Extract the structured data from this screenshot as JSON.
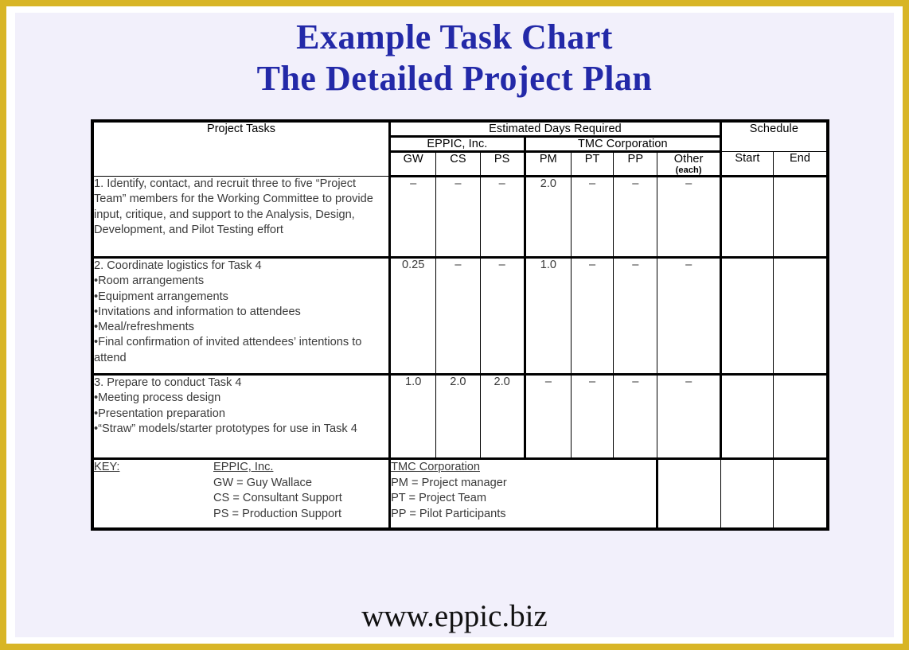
{
  "page": {
    "title_line1": "Example Task Chart",
    "title_line2": "The Detailed Project Plan",
    "footer": "www.eppic.biz",
    "title_color": "#2329a8",
    "border_color": "#d8b526",
    "background_color": "#f2f0fb"
  },
  "table": {
    "headers": {
      "project_tasks": "Project Tasks",
      "estimated_days_required": "Estimated Days Required",
      "schedule": "Schedule",
      "group_eppic": "EPPIC, Inc.",
      "group_tmc": "TMC Corporation",
      "col_gw": "GW",
      "col_cs": "CS",
      "col_ps": "PS",
      "col_pm": "PM",
      "col_pt": "PT",
      "col_pp": "PP",
      "col_other": "Other",
      "col_other_sub": "(each)",
      "col_start": "Start",
      "col_end": "End"
    },
    "rows": [
      {
        "task_title": "1. Identify, contact, and recruit three to five “Project Team” members for the Working Committee to provide input, critique, and support to the Analysis, Design, Development, and Pilot Testing effort",
        "bullets": [],
        "gw": "–",
        "cs": "–",
        "ps": "–",
        "pm": "2.0",
        "pt": "–",
        "pp": "–",
        "other": "–",
        "start": "",
        "end": ""
      },
      {
        "task_title": "2. Coordinate logistics for Task 4",
        "bullets": [
          "•Room arrangements",
          "•Equipment arrangements",
          "•Invitations and information to attendees",
          "•Meal/refreshments",
          "•Final confirmation of invited attendees’ intentions to attend"
        ],
        "gw": "0.25",
        "cs": "–",
        "ps": "–",
        "pm": "1.0",
        "pt": "–",
        "pp": "–",
        "other": "–",
        "start": "",
        "end": ""
      },
      {
        "task_title": "3. Prepare to conduct Task 4",
        "bullets": [
          "•Meeting process design",
          "•Presentation preparation",
          "•“Straw” models/starter prototypes for use in Task 4"
        ],
        "gw": "1.0",
        "cs": "2.0",
        "ps": "2.0",
        "pm": "–",
        "pt": "–",
        "pp": "–",
        "other": "–",
        "start": "",
        "end": ""
      }
    ],
    "key": {
      "label": "KEY:",
      "eppic_heading": "EPPIC, Inc.",
      "eppic_lines": [
        "GW = Guy Wallace",
        "CS = Consultant Support",
        "PS = Production Support"
      ],
      "tmc_heading": "TMC Corporation",
      "tmc_lines": [
        "PM = Project manager",
        "PT = Project Team",
        "PP = Pilot Participants"
      ]
    }
  }
}
